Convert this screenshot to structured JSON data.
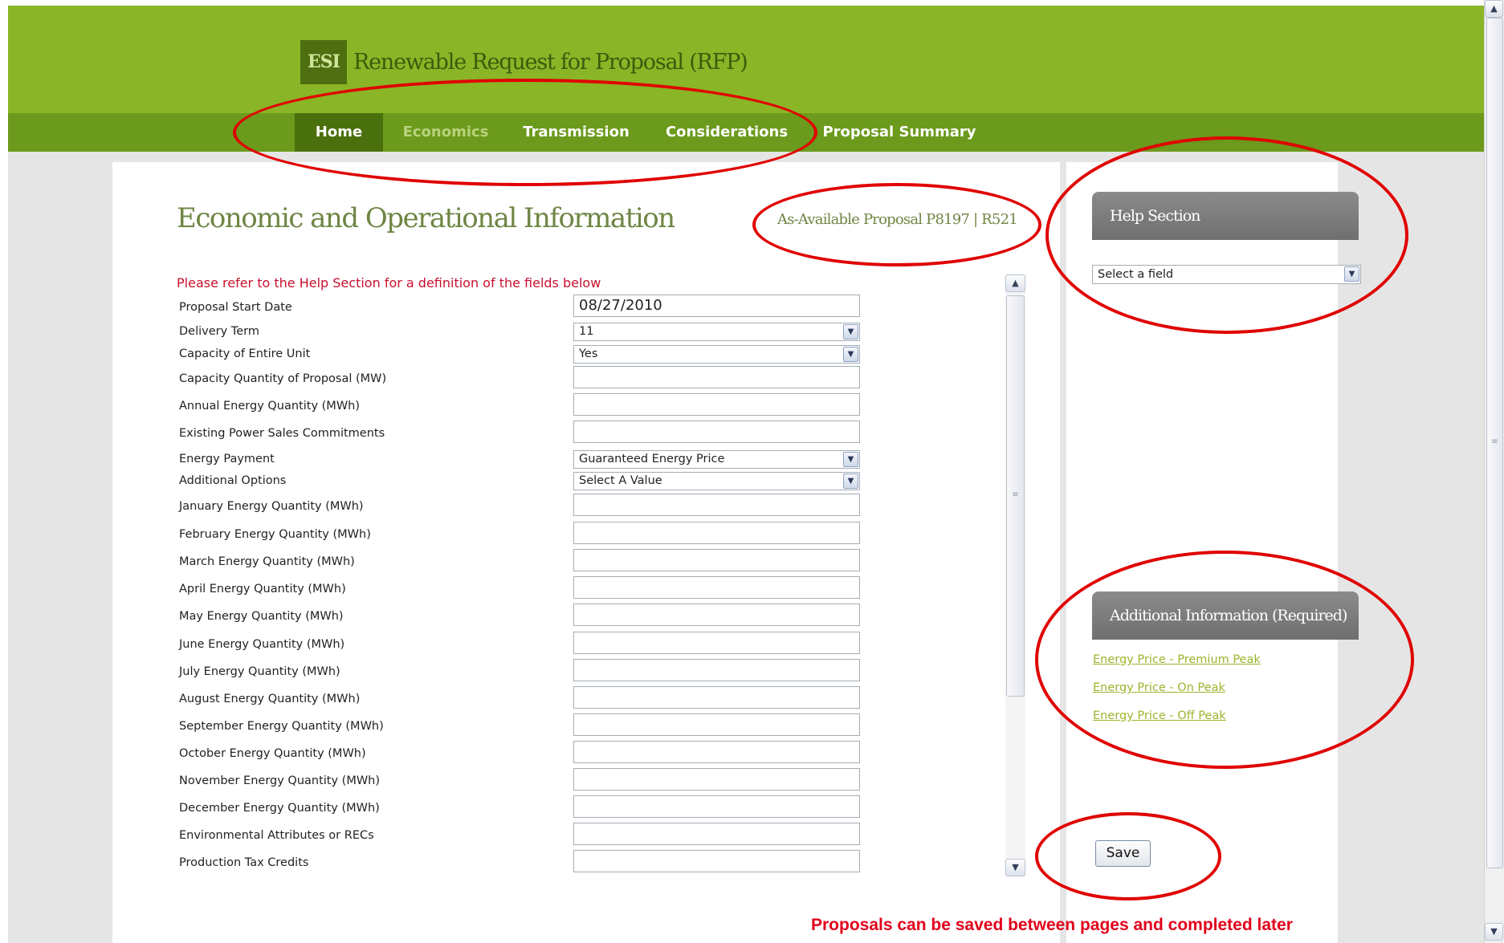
{
  "header": {
    "logo_text": "ESI",
    "app_title": "Renewable Request for Proposal (RFP)"
  },
  "nav": {
    "items": [
      {
        "label": "Home",
        "state": "active"
      },
      {
        "label": "Economics",
        "state": "current"
      },
      {
        "label": "Transmission",
        "state": "normal"
      },
      {
        "label": "Considerations",
        "state": "normal"
      },
      {
        "label": "Proposal Summary",
        "state": "normal"
      }
    ]
  },
  "main": {
    "title": "Economic and Operational Information",
    "proposal_id": "As-Available Proposal P8197 | R521",
    "instructions": "Please refer to the Help Section for a definition of the fields below",
    "fields": [
      {
        "label": "Proposal Start Date",
        "type": "text",
        "value": "08/27/2010"
      },
      {
        "label": "Delivery Term",
        "type": "select",
        "value": "11"
      },
      {
        "label": "Capacity of Entire Unit",
        "type": "select",
        "value": "Yes"
      },
      {
        "label": "Capacity Quantity of Proposal (MW)",
        "type": "text",
        "value": ""
      },
      {
        "label": "Annual Energy Quantity (MWh)",
        "type": "text",
        "value": ""
      },
      {
        "label": "Existing Power Sales Commitments",
        "type": "text",
        "value": ""
      },
      {
        "label": "Energy Payment",
        "type": "select",
        "value": "Guaranteed Energy Price"
      },
      {
        "label": "Additional Options",
        "type": "select",
        "value": "Select A Value"
      },
      {
        "label": "January Energy Quantity (MWh)",
        "type": "text",
        "value": ""
      },
      {
        "label": "February Energy Quantity (MWh)",
        "type": "text",
        "value": ""
      },
      {
        "label": "March Energy Quantity (MWh)",
        "type": "text",
        "value": ""
      },
      {
        "label": "April Energy Quantity (MWh)",
        "type": "text",
        "value": ""
      },
      {
        "label": "May Energy Quantity (MWh)",
        "type": "text",
        "value": ""
      },
      {
        "label": "June Energy Quantity (MWh)",
        "type": "text",
        "value": ""
      },
      {
        "label": "July Energy Quantity (MWh)",
        "type": "text",
        "value": ""
      },
      {
        "label": "August Energy Quantity (MWh)",
        "type": "text",
        "value": ""
      },
      {
        "label": "September Energy Quantity (MWh)",
        "type": "text",
        "value": ""
      },
      {
        "label": "October Energy Quantity (MWh)",
        "type": "text",
        "value": ""
      },
      {
        "label": "November Energy Quantity (MWh)",
        "type": "text",
        "value": ""
      },
      {
        "label": "December Energy Quantity (MWh)",
        "type": "text",
        "value": ""
      },
      {
        "label": "Environmental Attributes or RECs",
        "type": "text",
        "value": ""
      },
      {
        "label": "Production Tax Credits",
        "type": "text",
        "value": ""
      }
    ]
  },
  "sidebar": {
    "help_header": "Help Section",
    "help_select_value": "Select a field",
    "additional_header": "Additional Information (Required)",
    "links": [
      "Energy Price - Premium Peak",
      "Energy Price - On Peak",
      "Energy Price - Off Peak"
    ],
    "save_label": "Save",
    "save_note": "Proposals can be saved between pages and completed later"
  },
  "icons": {
    "select_arrow": "chevron-down-icon",
    "scroll_up": "scroll-up-arrow-icon",
    "scroll_down": "scroll-down-arrow-icon"
  },
  "colors": {
    "header_green": "#8ab526",
    "nav_green": "#6c9a1c",
    "nav_active": "#4a700d",
    "title_green": "#6f8543",
    "link_green": "#9ab52d",
    "annotation_red": "#e00000",
    "instruction_red": "#c8102e"
  }
}
